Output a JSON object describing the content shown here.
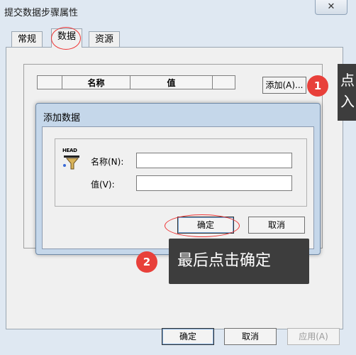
{
  "window": {
    "title": "提交数据步骤属性",
    "close_glyph": "✕"
  },
  "tabs": [
    {
      "label": "常规"
    },
    {
      "label": "数据"
    },
    {
      "label": "资源"
    }
  ],
  "table": {
    "columns": [
      "",
      "名称",
      "值",
      ""
    ]
  },
  "panel_buttons": {
    "add_label": "添加(A)..."
  },
  "modal": {
    "title": "添加数据",
    "icon_text": "HEAD",
    "icon": "head-data-icon",
    "name_label": "名称(N):",
    "name_value": "",
    "value_label": "值(V):",
    "value_value": "",
    "ok_label": "确定",
    "cancel_label": "取消"
  },
  "footer": {
    "ok_label": "确定",
    "cancel_label": "取消",
    "apply_label": "应用(A)"
  },
  "annotations": {
    "step1_number": "1",
    "step1_text": "点\n入",
    "step2_number": "2",
    "step2_text": "最后点击确定",
    "highlight_color": "#e8403a"
  }
}
